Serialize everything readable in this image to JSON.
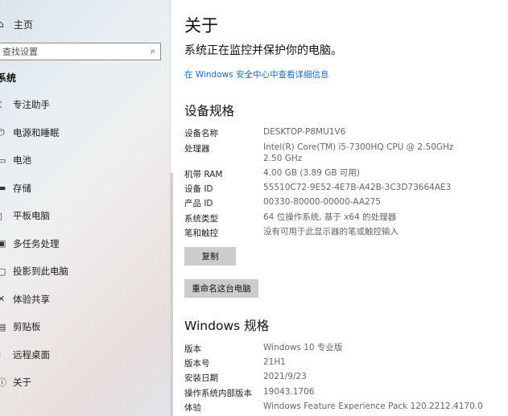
{
  "sidebar": {
    "home_label": "主页",
    "search_placeholder": "查找设置",
    "section_title": "系统",
    "items": [
      {
        "icon": "moon-icon",
        "label": "专注助手"
      },
      {
        "icon": "power-icon",
        "label": "电源和睡眠"
      },
      {
        "icon": "battery-icon",
        "label": "电池"
      },
      {
        "icon": "storage-icon",
        "label": "存储"
      },
      {
        "icon": "tablet-icon",
        "label": "平板电脑"
      },
      {
        "icon": "multitask-icon",
        "label": "多任务处理"
      },
      {
        "icon": "project-icon",
        "label": "投影到此电脑"
      },
      {
        "icon": "share-icon",
        "label": "体验共享"
      },
      {
        "icon": "clipboard-icon",
        "label": "剪贴板"
      },
      {
        "icon": "remote-desktop-icon",
        "label": "远程桌面"
      },
      {
        "icon": "info-icon",
        "label": "关于"
      }
    ]
  },
  "main": {
    "title": "关于",
    "protection_text": "系统正在监控并保护你的电脑。",
    "security_link": "在 Windows 安全中心中查看详细信息",
    "device_specs": {
      "heading": "设备规格",
      "rows": [
        {
          "key": "设备名称",
          "value": "DESKTOP-P8MU1V6"
        },
        {
          "key": "处理器",
          "value": "Intel(R) Core(TM) i5-7300HQ CPU @ 2.50GHz",
          "value2": "2.50 GHz"
        },
        {
          "key": "机带 RAM",
          "value": "4.00 GB (3.89 GB 可用)"
        },
        {
          "key": "设备 ID",
          "value": "55510C72-9E52-4E7B-A42B-3C3D73664AE3"
        },
        {
          "key": "产品 ID",
          "value": "00330-80000-00000-AA275"
        },
        {
          "key": "系统类型",
          "value": "64 位操作系统, 基于 x64 的处理器"
        },
        {
          "key": "笔和触控",
          "value": "没有可用于此显示器的笔或触控输入"
        }
      ],
      "copy_button": "复制",
      "rename_button": "重命名这台电脑"
    },
    "windows_specs": {
      "heading": "Windows 规格",
      "rows": [
        {
          "key": "版本",
          "value": "Windows 10 专业版"
        },
        {
          "key": "版本号",
          "value": "21H1"
        },
        {
          "key": "安装日期",
          "value": "2021/9/23"
        },
        {
          "key": "操作系统内部版本",
          "value": "19043.1706"
        },
        {
          "key": "体验",
          "value": "Windows Feature Experience Pack 120.2212.4170.0"
        }
      ]
    }
  }
}
